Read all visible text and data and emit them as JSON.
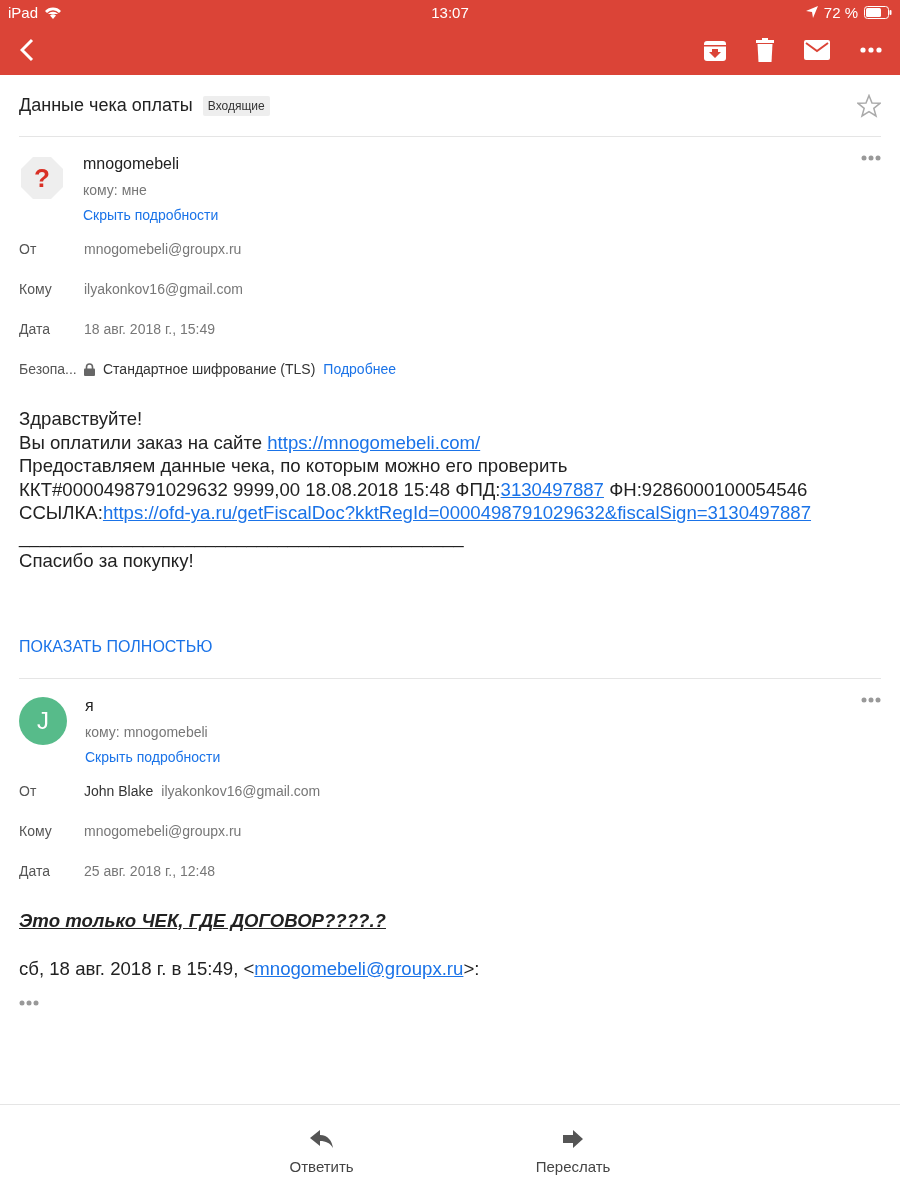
{
  "status_bar": {
    "device": "iPad",
    "time": "13:07",
    "battery": "72 %"
  },
  "subject": {
    "title": "Данные чека оплаты",
    "label": "Входящие",
    "starred": false
  },
  "messages": [
    {
      "sender": "mnogomebeli",
      "avatar": {
        "kind": "unknown",
        "symbol": "?"
      },
      "to_line": "кому: мне",
      "hide_details": "Скрыть подробности",
      "details": [
        {
          "kind": "text",
          "label": "От",
          "value": "mnogomebeli@groupx.ru"
        },
        {
          "kind": "text",
          "label": "Кому",
          "value": "ilyakonkov16@gmail.com"
        },
        {
          "kind": "text",
          "label": "Дата",
          "value": "18 авг. 2018 г., 15:49"
        },
        {
          "kind": "security",
          "label": "Безопа...",
          "value": "Стандартное шифрование (TLS)",
          "link": "Подробнее"
        }
      ],
      "body": [
        {
          "kind": "text",
          "segments": [
            {
              "text": "Здравствуйте!",
              "link": false
            }
          ]
        },
        {
          "kind": "text",
          "segments": [
            {
              "text": "Вы оплатили заказ на сайте ",
              "link": false
            },
            {
              "text": "https://mnogomebeli.com/",
              "link": true
            }
          ]
        },
        {
          "kind": "text",
          "segments": [
            {
              "text": "Предоставляем данные чека, по которым можно его проверить",
              "link": false
            }
          ]
        },
        {
          "kind": "text",
          "segments": [
            {
              "text": "ККТ#0000498791029632 9999,00 18.08.2018 15:48 ФПД:",
              "link": false
            },
            {
              "text": "3130497887",
              "link": true
            },
            {
              "text": " ФН:9286000100054546",
              "link": false
            }
          ]
        },
        {
          "kind": "text",
          "segments": [
            {
              "text": "ССЫЛКА:",
              "link": false
            },
            {
              "text": "https://ofd-ya.ru/getFiscalDoc?kktRegId=0000498791029632&fiscalSign=3130497887",
              "link": true
            }
          ]
        },
        {
          "kind": "text",
          "segments": [
            {
              "text": "___________________________________________",
              "link": false
            }
          ]
        },
        {
          "kind": "text",
          "segments": [
            {
              "text": "Спасибо за покупку!",
              "link": false
            }
          ]
        }
      ],
      "show_full": "ПОКАЗАТЬ ПОЛНОСТЬЮ"
    },
    {
      "sender": "я",
      "avatar": {
        "kind": "letter",
        "letter": "J",
        "color": "#57bb8a"
      },
      "to_line": "кому: mnogomebeli",
      "hide_details": "Скрыть подробности",
      "details": [
        {
          "kind": "text",
          "label": "От",
          "name": "John Blake",
          "value": "ilyakonkov16@gmail.com"
        },
        {
          "kind": "text",
          "label": "Кому",
          "value": "mnogomebeli@groupx.ru"
        },
        {
          "kind": "text",
          "label": "Дата",
          "value": "25 авг. 2018 г., 12:48"
        }
      ],
      "body": [
        {
          "kind": "emphasis",
          "segments": [
            {
              "text": "Это только ЧЕК, ГДЕ ДОГОВОР????.?",
              "link": false
            }
          ]
        },
        {
          "kind": "quote",
          "segments": [
            {
              "text": "сб, 18 авг. 2018 г. в 15:49, <",
              "link": false
            },
            {
              "text": "mnogomebeli@groupx.ru",
              "link": true
            },
            {
              "text": ">:",
              "link": false
            }
          ]
        }
      ],
      "trimmed": true
    }
  ],
  "actions": [
    {
      "kind": "reply",
      "label": "Ответить"
    },
    {
      "kind": "forward",
      "label": "Переслать"
    }
  ]
}
